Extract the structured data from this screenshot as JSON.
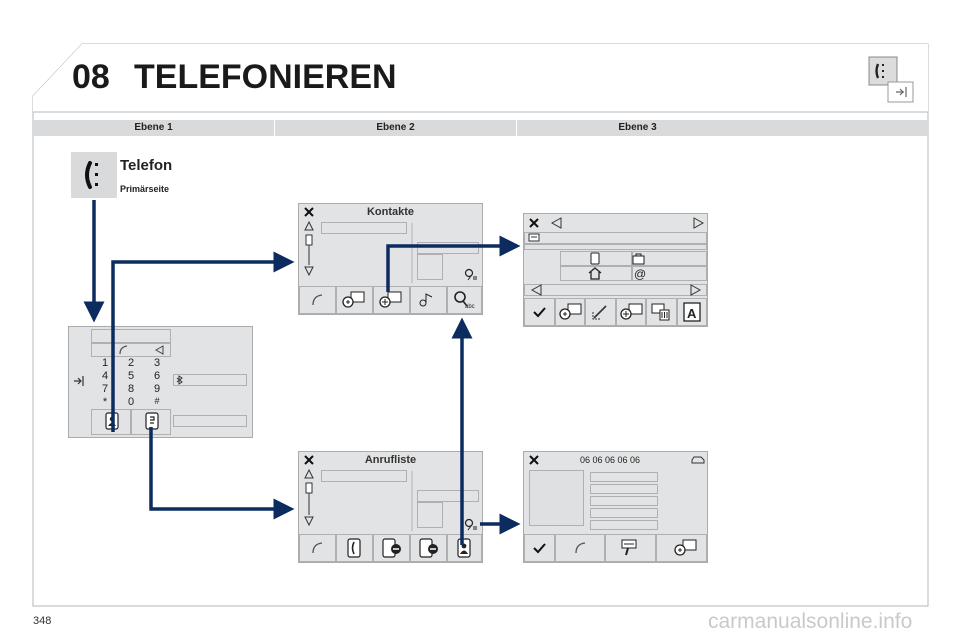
{
  "header": {
    "chapter_number": "08",
    "chapter_title": "TELEFONIEREN"
  },
  "levels": [
    "Ebene 1",
    "Ebene 2",
    "Ebene 3"
  ],
  "phone_menu": {
    "title": "Telefon",
    "subtitle": "Primärseite",
    "icon": "phone-handset-icon"
  },
  "keypad": {
    "keys": [
      "1",
      "2",
      "3",
      "4",
      "5",
      "6",
      "7",
      "8",
      "9",
      "*",
      "0",
      "#"
    ],
    "icons": [
      "handset-icon",
      "back-arrow-icon",
      "exit-icon",
      "bluetooth-icon",
      "contacts-icon",
      "call-log-icon"
    ]
  },
  "contacts_screen": {
    "title": "Kontakte",
    "icons": [
      "close-icon",
      "up-arrow-icon",
      "scroll-bar-icon",
      "down-arrow-icon",
      "search-list-icon",
      "call-icon",
      "add-contact-icon",
      "new-contact-icon",
      "sort-icon",
      "search-abc-icon"
    ]
  },
  "contact_detail_screen": {
    "icons": [
      "close-icon",
      "prev-icon",
      "next-icon",
      "card-icon",
      "mobile-icon",
      "work-icon",
      "home-icon",
      "at-icon",
      "prev-icon",
      "next-icon",
      "check-icon",
      "add-contact-icon",
      "edit-icon",
      "new-contact-icon",
      "delete-icon",
      "font-icon"
    ]
  },
  "call_log_screen": {
    "title": "Anrufliste",
    "icons": [
      "close-icon",
      "up-arrow-icon",
      "scroll-bar-icon",
      "down-arrow-icon",
      "search-list-icon",
      "call-icon",
      "missed-calls-icon",
      "dialed-calls-icon",
      "received-calls-icon",
      "contacts-icon"
    ]
  },
  "call_detail_screen": {
    "number": "06 06 06 06 06",
    "icons": [
      "close-icon",
      "car-icon",
      "check-icon",
      "call-icon",
      "delete-icon",
      "add-contact-icon"
    ]
  },
  "footer": {
    "page_number": "348",
    "watermark": "carmanualsonline.info"
  },
  "colors": {
    "arrow": "#0c2b5e",
    "panel": "#e2e3e4",
    "header_bar": "#d9dadb"
  }
}
